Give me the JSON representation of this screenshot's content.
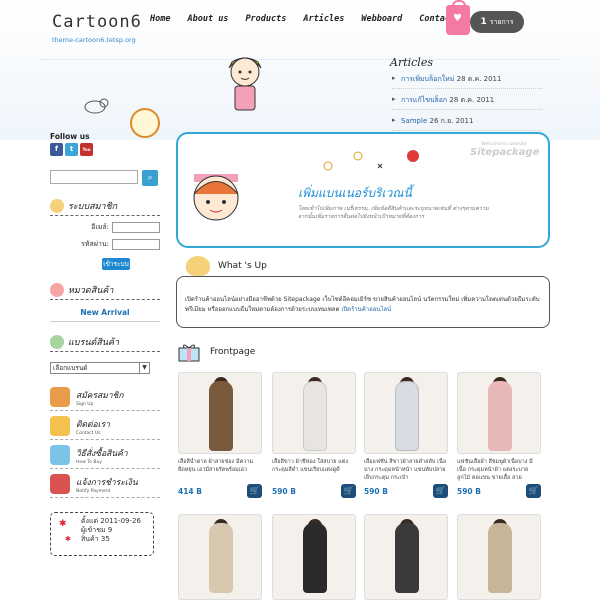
{
  "header": {
    "logo": "Cartoon6",
    "subtitle": "theme-cartoon6.tetsp.org",
    "nav": [
      "Home",
      "About us",
      "Products",
      "Articles",
      "Webboard",
      "Contact us"
    ],
    "cart_count": "1",
    "cart_unit": "รายการ"
  },
  "articles": {
    "title": "Articles",
    "items": [
      {
        "title": "การเพิ่มบล็อกใหม่",
        "date": "28 ต.ค. 2011"
      },
      {
        "title": "การแก้ไขบล็อก",
        "date": "28 ต.ค. 2011"
      },
      {
        "title": "Sample",
        "date": "26 ก.ย. 2011"
      }
    ]
  },
  "sidebar": {
    "follow_label": "Follow us",
    "social": [
      "f",
      "t",
      "You"
    ],
    "member_title": "ระบบสมาชิก",
    "email_label": "อีเมล์:",
    "password_label": "รหัสผ่าน:",
    "login_button": "เข้าระบบ",
    "category_title": "หมวดสินค้า",
    "new_arrival": "New Arrival",
    "brand_title": "แบรนด์สินค้า",
    "brand_select": "เลือกแบรนด์",
    "links": [
      {
        "label": "สมัครสมาชิก",
        "sub": "Sign Up"
      },
      {
        "label": "ติดต่อเรา",
        "sub": "Contact Us"
      },
      {
        "label": "วิธีสั่งซื้อสินค้า",
        "sub": "How To Buy"
      },
      {
        "label": "แจ้งการชำระเงิน",
        "sub": "Notify Payment"
      }
    ],
    "stats": {
      "created": "ตั้งแต่  2011-09-26",
      "visitors": "ผู้เข้าชม  9",
      "products": "สินค้า  35"
    }
  },
  "banner": {
    "title": "เพิ่มแบนเนอร์บริเวณนี้",
    "text": "โดยเข้าไปเพิ่มภาพ เนรี่เธรรม, เพิ่มข้อดีสินค้าและระบุขนาดเช่นที่  ต่างๆตามความ จากนั้นเพิ่มรายการอื่นต่อไปยังหน้าเป้าหมายที่ต้องการ",
    "watermark_small": "Welcome to website",
    "watermark_big": "Sitepackage"
  },
  "whats_up": {
    "title": "What 's Up",
    "text": "เปิดร้านค้าออนไลน์อย่างมืออาชีพด้วย Sitepackage เว็บไซต์อีคอมเมิร์ซ ขายสินค้าออนไลน์ นวัตกรรมใหม่ เพิ่มความโดดเด่นด้วยธีมระดับพรีเมียม หรือออกแบบธีมใหม่ตามต้องการด้วยระบบเทมเพลต",
    "link": "เปิดร้านค้าออนไลน์"
  },
  "frontpage": {
    "title": "Frontpage",
    "products": [
      {
        "desc": "เสื้อสีน้ำตาล ผ้าลายช่อง มีความยืดหยุ่น เอวมีสายรัดพร้อมเอว",
        "price": "414 B",
        "color": "#7a5a3c"
      },
      {
        "desc": "เสื้อสีขาว ผ้าชีฟอง ใส่สบาย แต่งกระดุมสีดำ แขนเรียบแต่งดูดี",
        "price": "590 B",
        "color": "#e8e4e0"
      },
      {
        "desc": "เสื้อแฟชั่น สีขาวผ้าลายดำสลับ เนื้อบาง กระดุมหน้าหน้า แขนพับปลายเย็บกระดุม กระเป๋า",
        "price": "590 B",
        "color": "#d9dde3"
      },
      {
        "desc": "แฟชั่นเสื้อผ้า สีชมพูผ้าเนื้อบาง มีเนื้อ กระดุมหน้าผ้า แต่งระบายลูกไม้ คอแขน ขายเสื้อ สวย",
        "price": "590 B",
        "color": "#e8b8b8"
      },
      {
        "desc": "",
        "price": "",
        "color": "#d9c8b0"
      },
      {
        "desc": "",
        "price": "",
        "color": "#2a2a2a"
      },
      {
        "desc": "",
        "price": "",
        "color": "#3a3a3a"
      },
      {
        "desc": "",
        "price": "",
        "color": "#c7b59a"
      }
    ]
  },
  "colors": {
    "accent": "#34a6d8",
    "price": "#1e6fb5",
    "cart_bag": "#f47aa4"
  }
}
